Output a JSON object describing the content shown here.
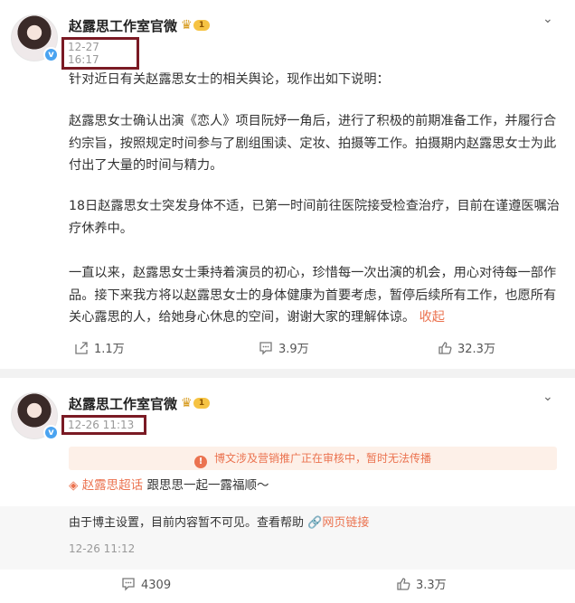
{
  "post1": {
    "username": "赵露思工作室官微",
    "level": "1",
    "time": "12-27 16:17",
    "paragraphs": [
      "针对近日有关赵露思女士的相关舆论，现作出如下说明：",
      "赵露思女士确认出演《恋人》项目阮妤一角后，进行了积极的前期准备工作，并履行合约宗旨，按照规定时间参与了剧组围读、定妆、拍摄等工作。拍摄期内赵露思女士为此付出了大量的时间与精力。",
      "18日赵露思女士突发身体不适，已第一时间前往医院接受检查治疗，目前在谨遵医嘱治疗休养中。",
      "一直以来，赵露思女士秉持着演员的初心，珍惜每一次出演的机会，用心对待每一部作品。接下来我方将以赵露思女士的身体健康为首要考虑，暂停后续所有工作，也愿所有关心露思的人，给她身心休息的空间，谢谢大家的理解体谅。"
    ],
    "collapse_label": "收起",
    "actions": {
      "share": "1.1万",
      "comment": "3.9万",
      "like": "32.3万"
    }
  },
  "post2": {
    "username": "赵露思工作室官微",
    "level": "1",
    "time": "12-26 11:13",
    "warning": "博文涉及营销推广正在审核中，暂时无法传播",
    "topic_link": "赵露思超话",
    "topic_text": "跟思思一起一露福顺～",
    "hidden_note": "由于博主设置，目前内容暂不可见。查看帮助",
    "web_link": "网页链接",
    "orig_time": "12-26 11:12",
    "actions": {
      "comment": "4309",
      "like": "3.3万"
    }
  },
  "colors": {
    "accent": "#eb7350",
    "highlight_box": "#7a1a24",
    "verified": "#4aa3f0"
  },
  "icons": [
    "chevron-down-icon",
    "verified-icon",
    "crown-icon",
    "share-icon",
    "comment-icon",
    "like-icon",
    "warning-icon",
    "topic-icon",
    "link-icon"
  ]
}
